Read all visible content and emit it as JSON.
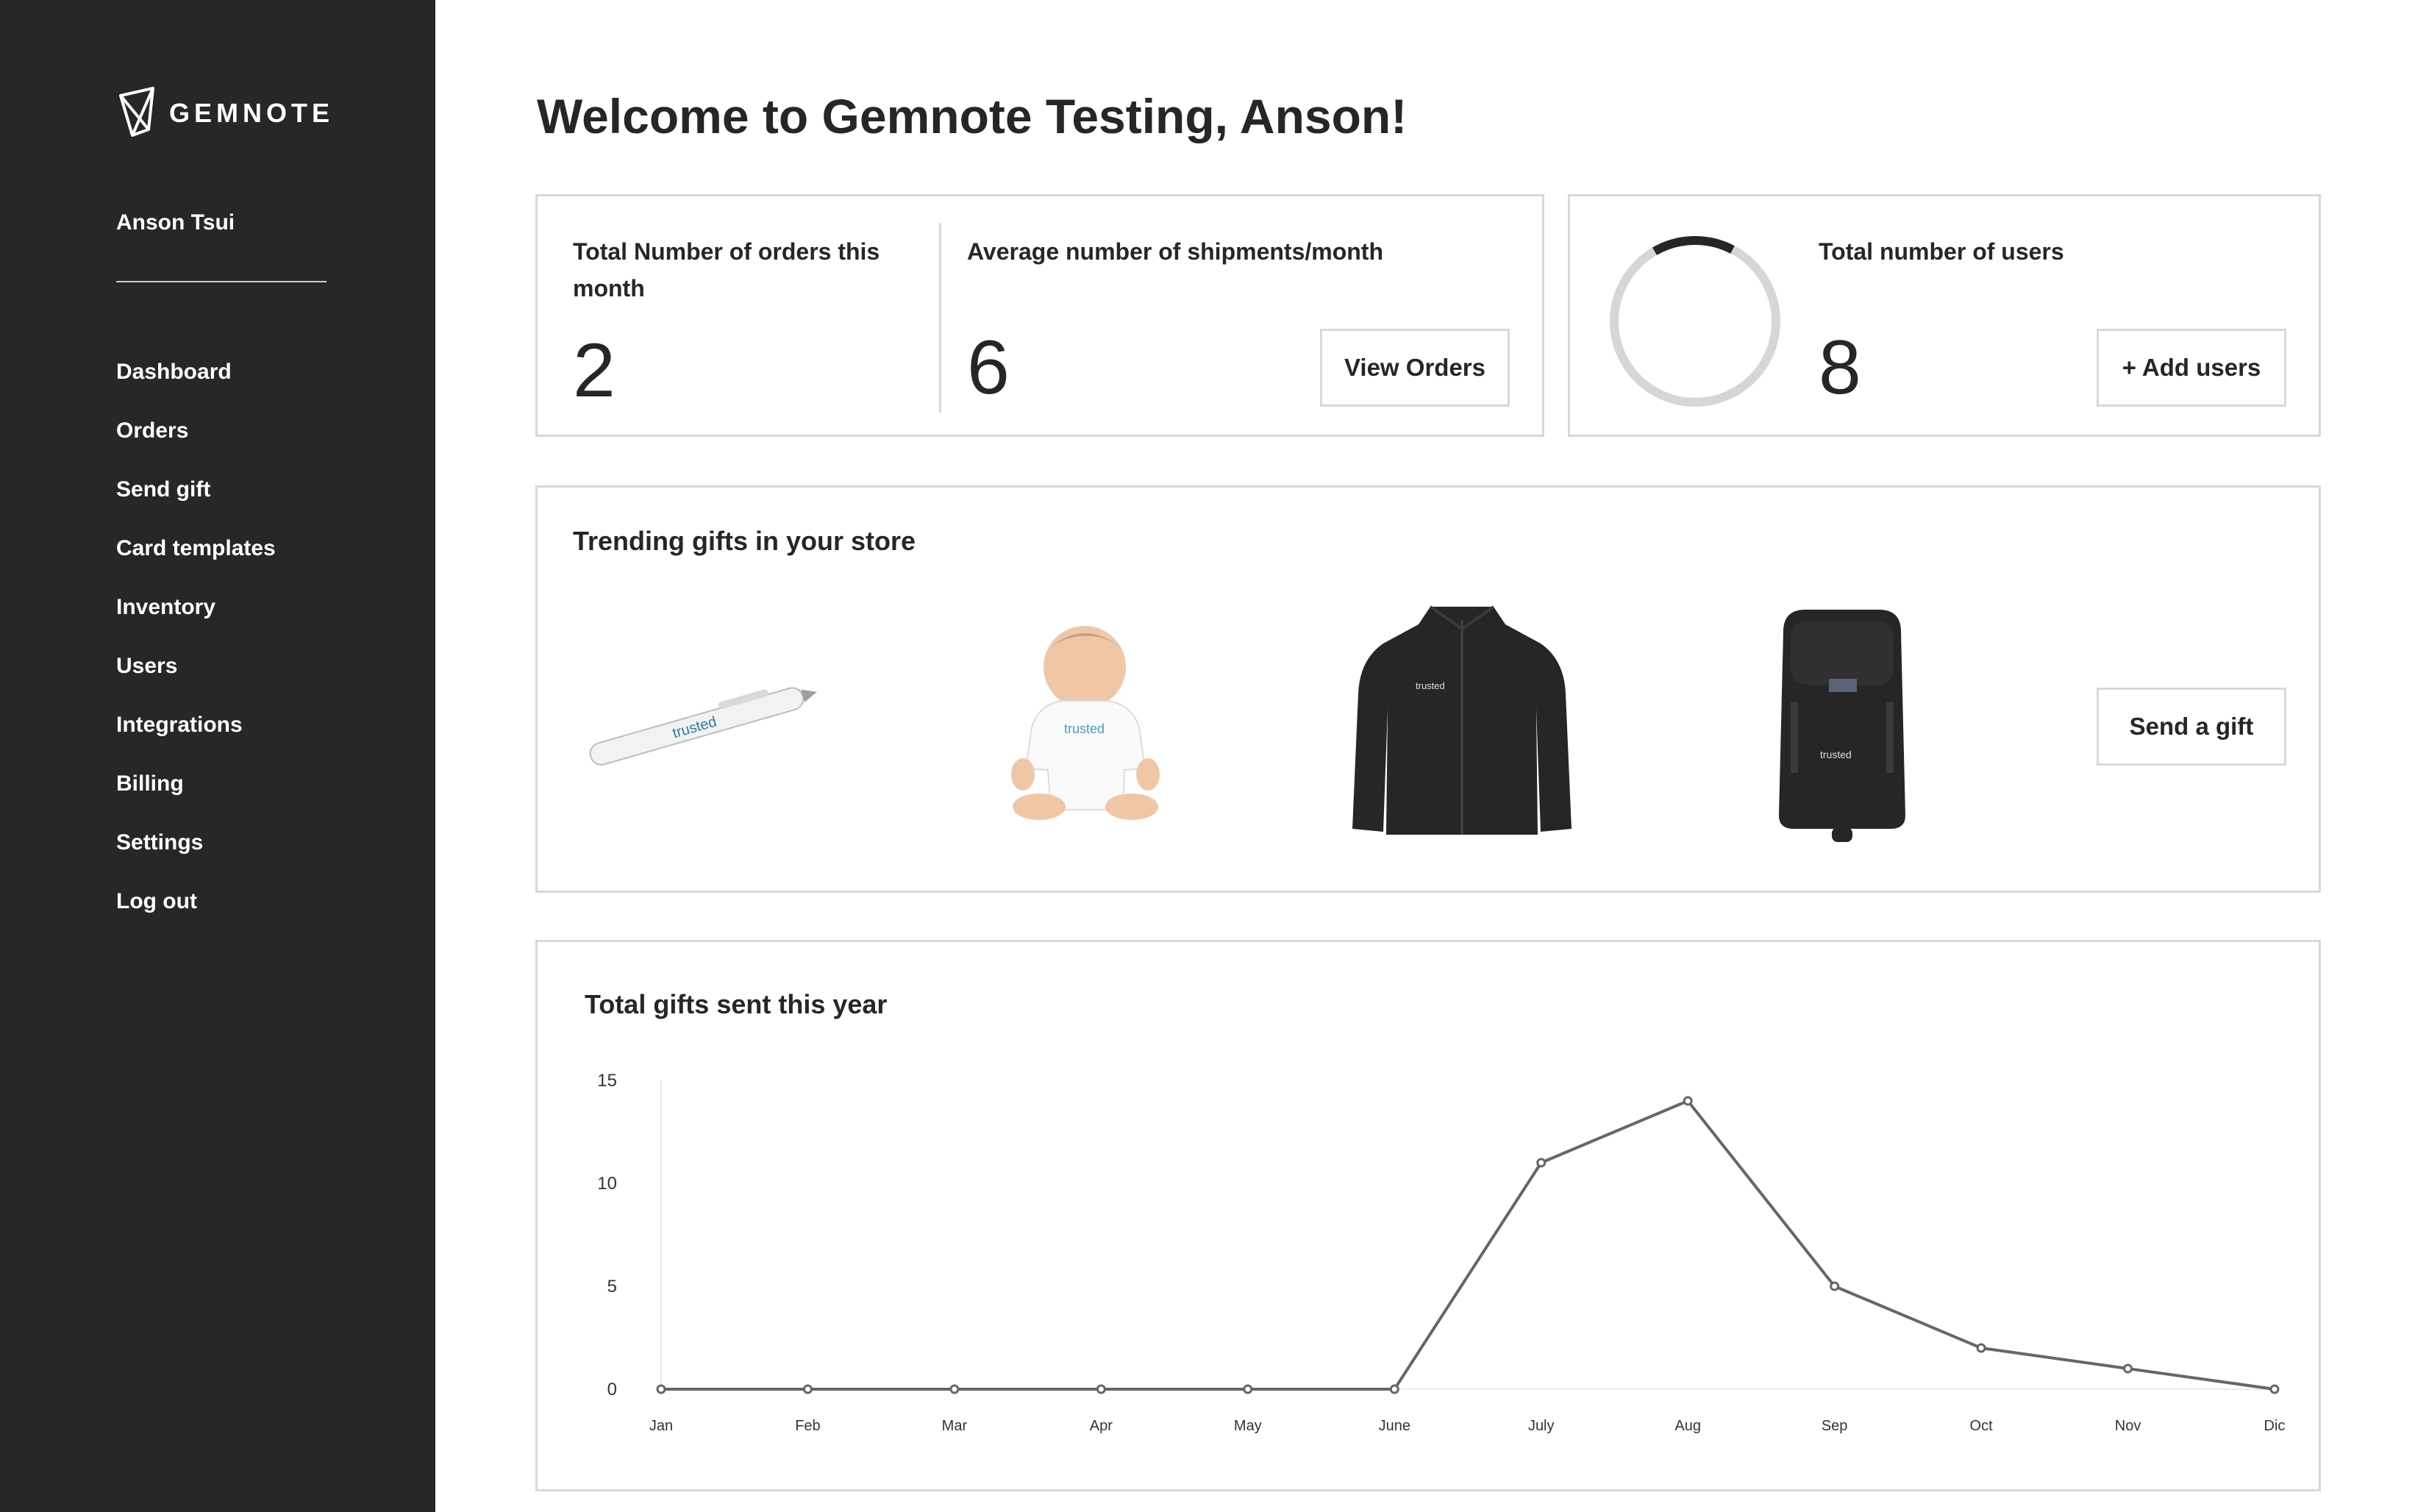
{
  "brand": {
    "name": "GEMNOTE",
    "logo_icon": "gemnote-logo-icon"
  },
  "sidebar": {
    "user_name": "Anson Tsui",
    "items": [
      {
        "label": "Dashboard"
      },
      {
        "label": "Orders"
      },
      {
        "label": "Send gift"
      },
      {
        "label": "Card templates"
      },
      {
        "label": "Inventory"
      },
      {
        "label": "Users"
      },
      {
        "label": "Integrations"
      },
      {
        "label": "Billing"
      },
      {
        "label": "Settings"
      },
      {
        "label": "Log out"
      }
    ]
  },
  "main": {
    "title": "Welcome to Gemnote Testing, Anson!",
    "orders_card": {
      "total_orders_label": "Total Number of orders this month",
      "total_orders_value": "2",
      "avg_shipments_label": "Average number of shipments/month",
      "avg_shipments_value": "6",
      "view_orders_button": "View Orders"
    },
    "users_card": {
      "label": "Total number of users",
      "value": "8",
      "add_users_button": "+ Add users",
      "ring_fill_fraction": 0.16
    },
    "trending": {
      "title": "Trending gifts in your store",
      "items": [
        {
          "icon": "pen-icon",
          "brand_text": "trusted"
        },
        {
          "icon": "baby-onesie-icon",
          "brand_text": "trusted"
        },
        {
          "icon": "fleece-jacket-icon",
          "brand_text": "trusted"
        },
        {
          "icon": "backpack-icon",
          "brand_text": "trusted"
        }
      ],
      "send_gift_button": "Send a gift"
    }
  },
  "chart_data": {
    "type": "line",
    "title": "Total gifts sent this year",
    "categories": [
      "Jan",
      "Feb",
      "Mar",
      "Apr",
      "May",
      "June",
      "July",
      "Aug",
      "Sep",
      "Oct",
      "Nov",
      "Dic"
    ],
    "series": [
      {
        "values": [
          0,
          0,
          0,
          0,
          0,
          0,
          11,
          14,
          5,
          2,
          1,
          0
        ]
      }
    ],
    "y_ticks": [
      "0",
      "5",
      "10",
      "15"
    ],
    "ylim": [
      0,
      15
    ],
    "xlabel": "",
    "ylabel": "",
    "grid": false,
    "line_color": "#666666"
  }
}
